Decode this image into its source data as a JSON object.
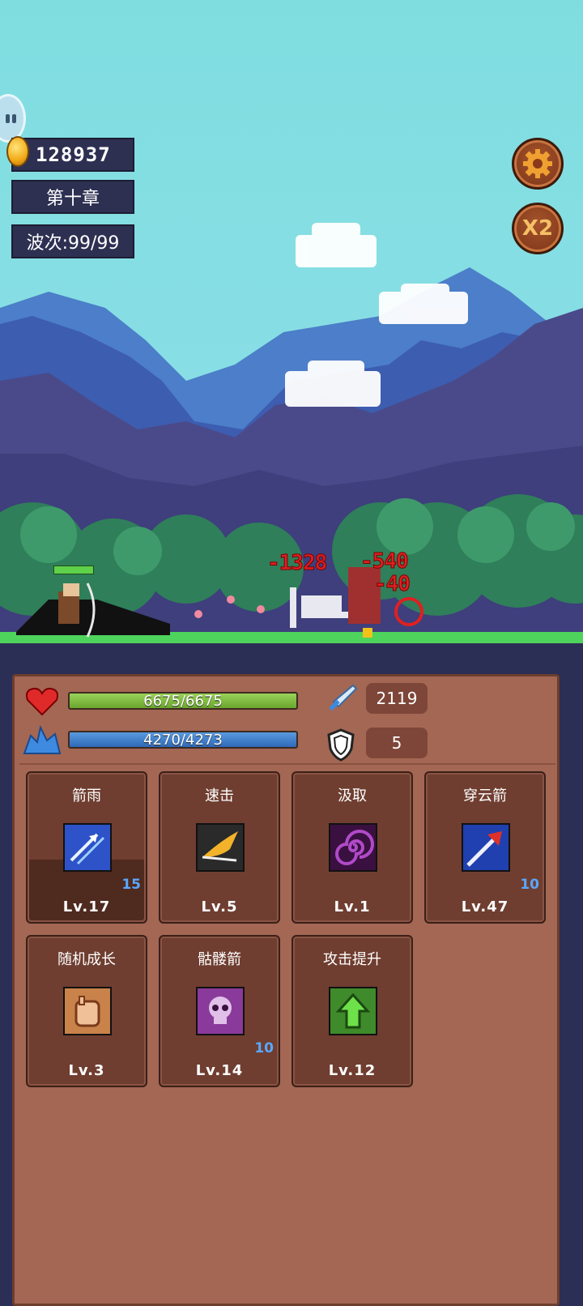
{
  "hud": {
    "coins": "128937",
    "chapter": "第十章",
    "wave": "波次:99/99",
    "speed_label": "X2"
  },
  "damage_numbers": [
    "-1328",
    "-540",
    "-40"
  ],
  "stats": {
    "hp": "6675/6675",
    "mp": "4270/4273",
    "attack": "2119",
    "defense": "5",
    "hp_fraction": 1.0,
    "mp_fraction": 0.999
  },
  "skills": [
    {
      "name": "箭雨",
      "level": "Lv.17",
      "count": "15",
      "icon": "arrow-rain-icon",
      "color": "#2e52c8"
    },
    {
      "name": "速击",
      "level": "Lv.5",
      "count": "",
      "icon": "quick-strike-icon",
      "color": "#2a2a2a"
    },
    {
      "name": "汲取",
      "level": "Lv.1",
      "count": "",
      "icon": "drain-icon",
      "color": "#3a1040"
    },
    {
      "name": "穿云箭",
      "level": "Lv.47",
      "count": "10",
      "icon": "piercing-arrow-icon",
      "color": "#2040b0"
    },
    {
      "name": "随机成长",
      "level": "Lv.3",
      "count": "",
      "icon": "random-growth-icon",
      "color": "#c9824a"
    },
    {
      "name": "骷髅箭",
      "level": "Lv.14",
      "count": "10",
      "icon": "skull-arrow-icon",
      "color": "#8a3a9a"
    },
    {
      "name": "攻击提升",
      "level": "Lv.12",
      "count": "",
      "icon": "attack-up-icon",
      "color": "#3f8a2a"
    }
  ]
}
